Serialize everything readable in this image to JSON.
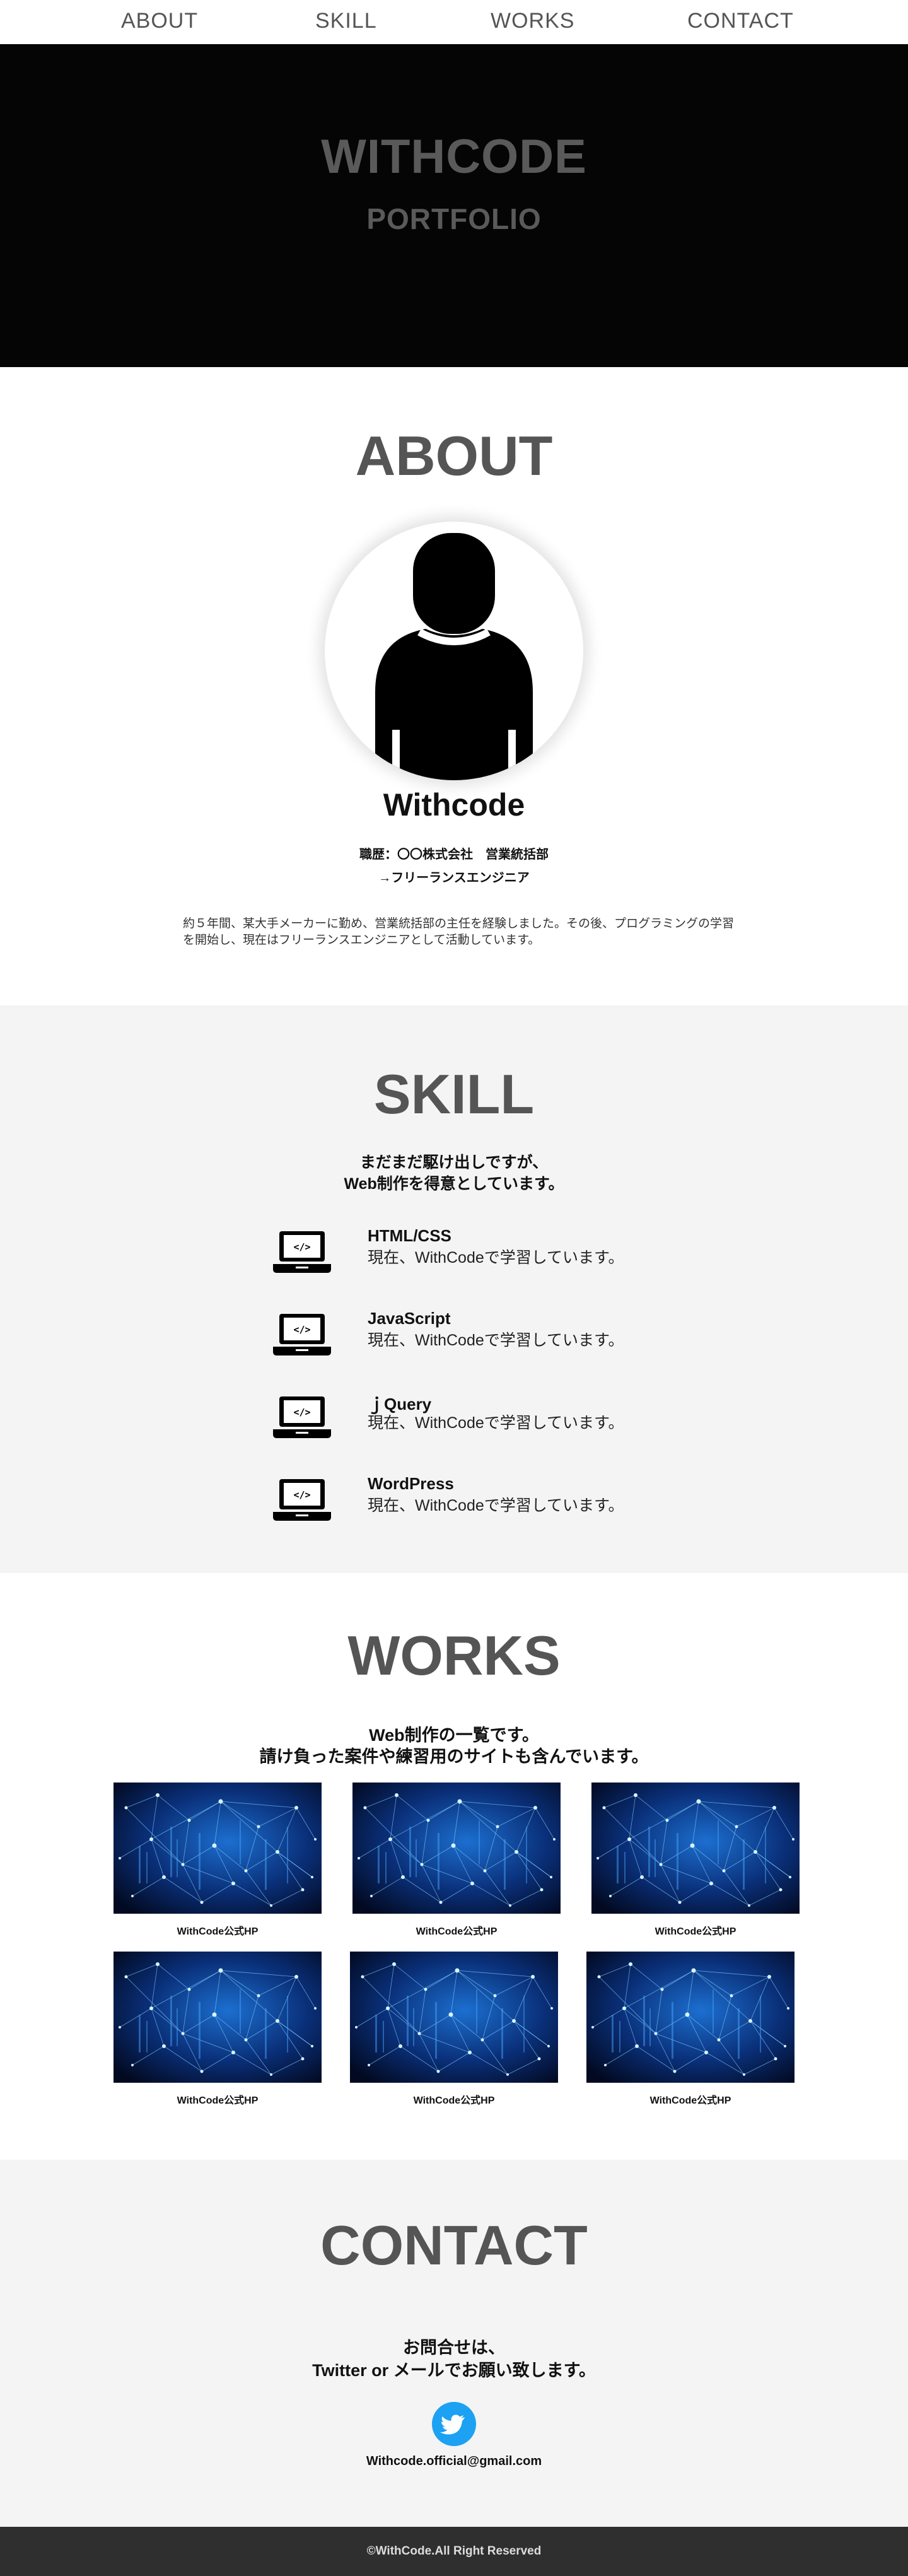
{
  "nav": {
    "items": [
      {
        "label": "ABOUT"
      },
      {
        "label": "SKILL"
      },
      {
        "label": "WORKS"
      },
      {
        "label": "CONTACT"
      }
    ]
  },
  "hero": {
    "title": "WITHCODE",
    "subtitle": "PORTFOLIO"
  },
  "about": {
    "heading": "ABOUT",
    "avatar_icon": "person-silhouette-icon",
    "name": "Withcode",
    "career_line1": "職歴：〇〇株式会社　営業統括部",
    "career_line2": "→フリーランスエンジニア",
    "description": "約５年間、某大手メーカーに勤め、営業統括部の主任を経験しました。その後、プログラミングの学習を開始し、現在はフリーランスエンジニアとして活動しています。"
  },
  "skill": {
    "heading": "SKILL",
    "lead_line1": "まだまだ駆け出しですが、",
    "lead_line2": "Web制作を得意としています。",
    "items": [
      {
        "icon": "laptop-code-icon",
        "name": "HTML/CSS",
        "desc": "現在、WithCodeで学習しています。"
      },
      {
        "icon": "laptop-code-icon",
        "name": "JavaScript",
        "desc": "現在、WithCodeで学習しています。"
      },
      {
        "icon": "laptop-code-icon",
        "name": "ｊQuery",
        "desc": "現在、WithCodeで学習しています。"
      },
      {
        "icon": "laptop-code-icon",
        "name": "WordPress",
        "desc": "現在、WithCodeで学習しています。"
      }
    ]
  },
  "works": {
    "heading": "WORKS",
    "lead_line1": "Web制作の一覧です。",
    "lead_line2": "請け負った案件や練習用のサイトも含んでいます。",
    "items": [
      {
        "caption": "WithCode公式HP"
      },
      {
        "caption": "WithCode公式HP"
      },
      {
        "caption": "WithCode公式HP"
      },
      {
        "caption": "WithCode公式HP"
      },
      {
        "caption": "WithCode公式HP"
      },
      {
        "caption": "WithCode公式HP"
      }
    ]
  },
  "contact": {
    "heading": "CONTACT",
    "lead_line1": "お問合せは、",
    "lead_line2": "Twitter or メールでお願い致します。",
    "twitter_icon": "twitter-bird-icon",
    "twitter_color": "#1da1f2",
    "email": "Withcode.official@gmail.com"
  },
  "footer": {
    "copyright": "©WithCode.All Right Reserved"
  }
}
